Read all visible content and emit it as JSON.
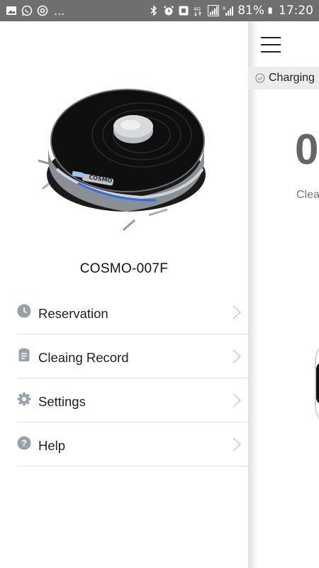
{
  "status_bar": {
    "left_icons": [
      "image-icon",
      "whatsapp-icon",
      "at-sign-icon"
    ],
    "more": "...",
    "right_icons": [
      "bluetooth-icon",
      "alarm-icon",
      "nfc-icon",
      "lte-4g-icon",
      "signal-icon",
      "roaming-signal-icon"
    ],
    "battery_percent": "81%",
    "time": "17:20"
  },
  "drawer": {
    "device_name": "COSMO-007F",
    "menu": [
      {
        "label": "Reservation",
        "icon": "clock-icon"
      },
      {
        "label": "Cleaing Record",
        "icon": "clipboard-icon"
      },
      {
        "label": "Settings",
        "icon": "gear-icon"
      },
      {
        "label": "Help",
        "icon": "question-circle-icon"
      }
    ]
  },
  "main": {
    "status_label": "Charging",
    "big_value": "0",
    "sub_label": "Clea"
  },
  "colors": {
    "status_bar_bg": "#6f6f6f",
    "icon_gray": "#9aa0a8",
    "divider": "#dfe0e6",
    "charging_bg": "#ececec"
  }
}
